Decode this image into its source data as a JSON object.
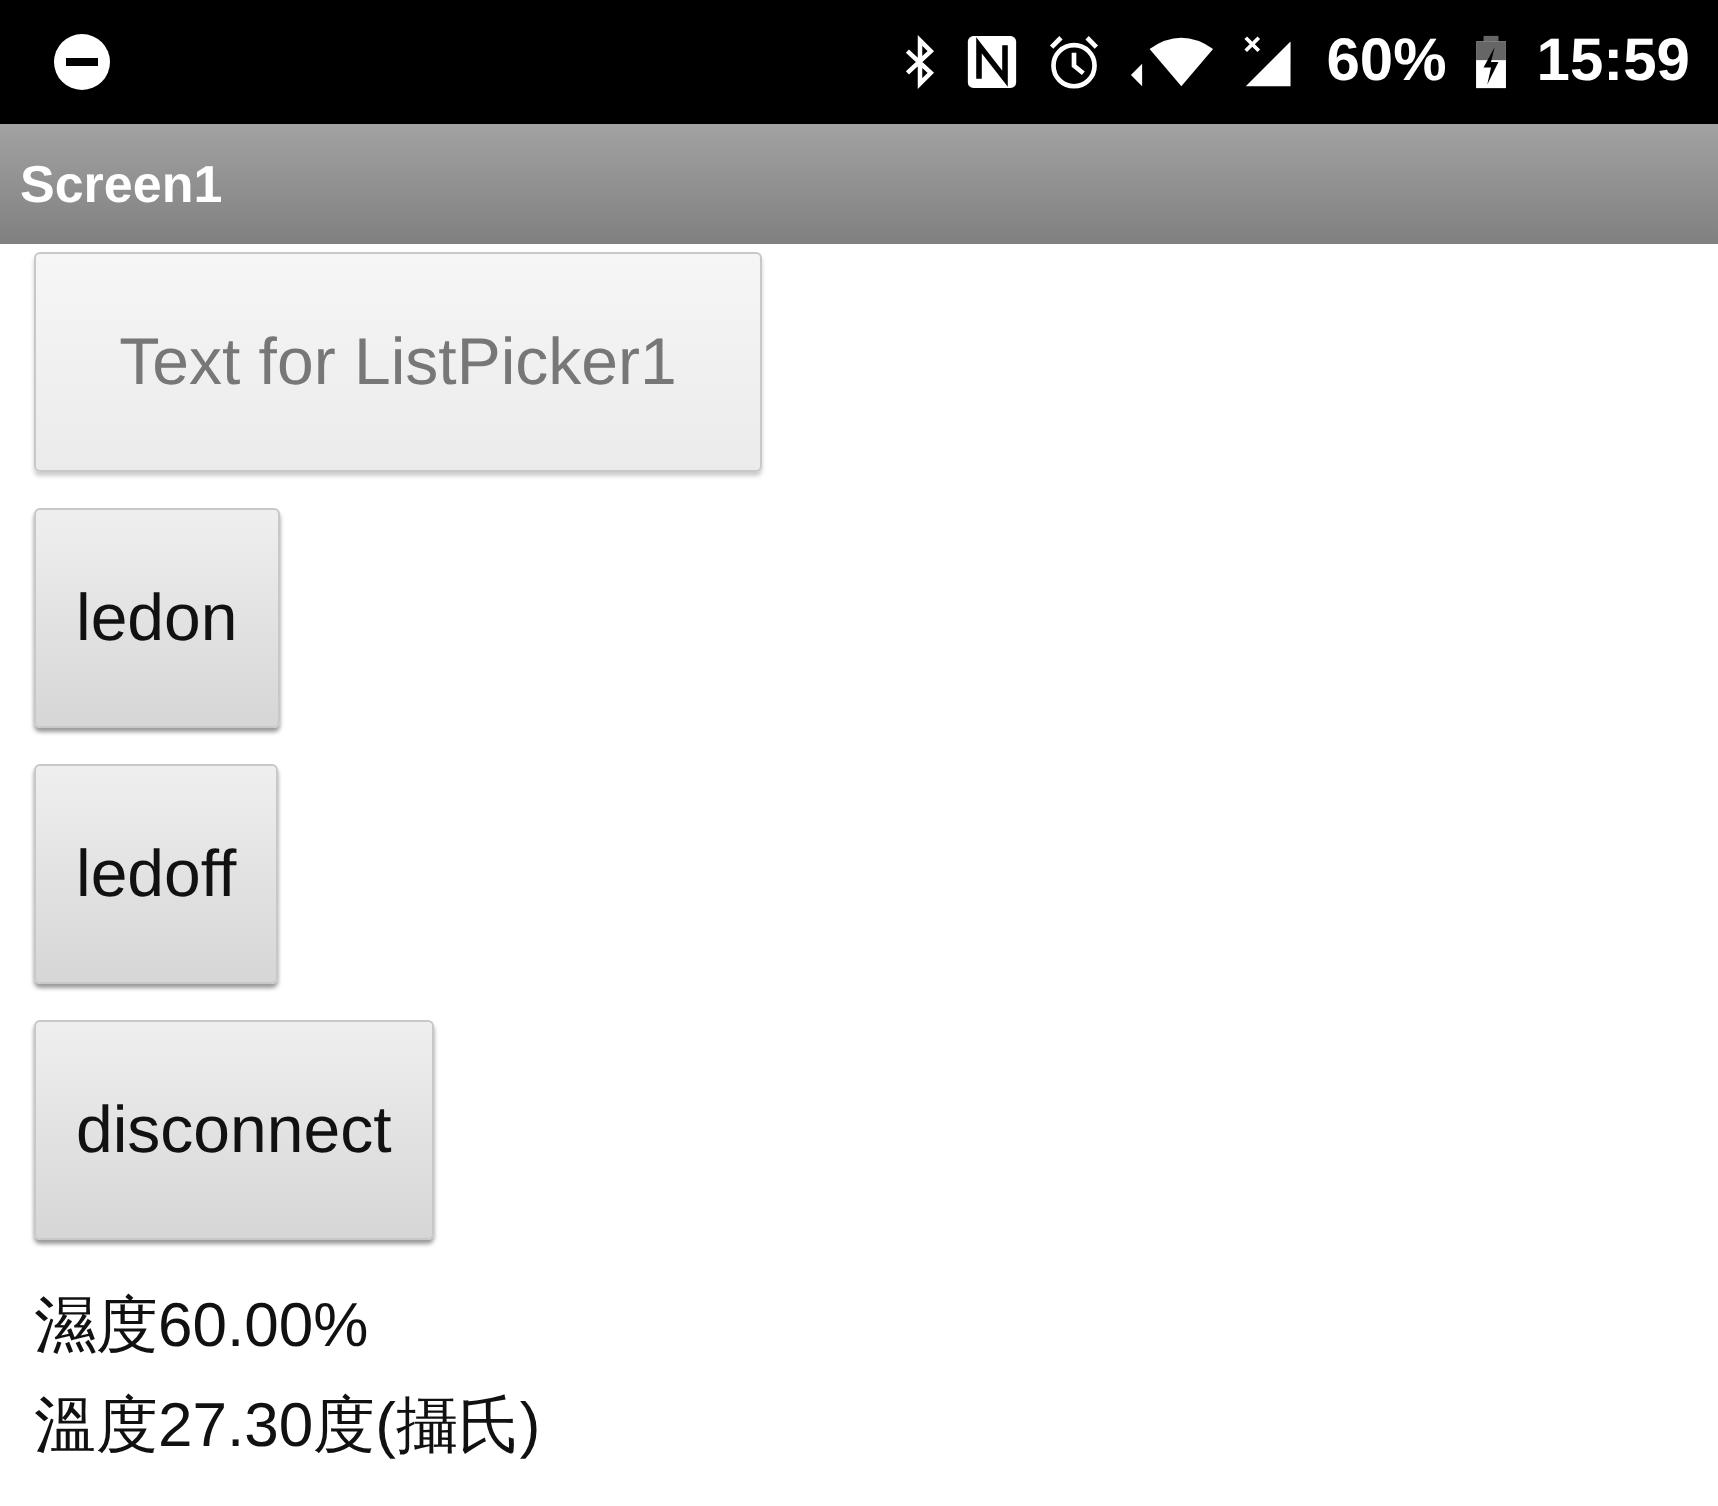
{
  "status_bar": {
    "battery": "60%",
    "time": "15:59"
  },
  "title_bar": {
    "title": "Screen1"
  },
  "buttons": [
    {
      "kind": "picker",
      "label": "Text for ListPicker1"
    },
    {
      "kind": "button",
      "label": "ledon"
    },
    {
      "kind": "button",
      "label": "ledoff"
    },
    {
      "kind": "button",
      "label": "disconnect"
    }
  ],
  "labels": [
    "濕度60.00%",
    "溫度27.30度(攝氏)"
  ]
}
